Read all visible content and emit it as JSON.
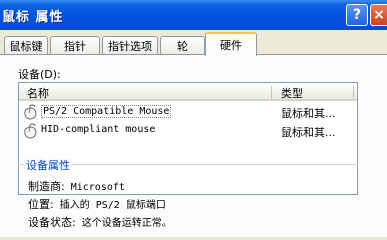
{
  "window": {
    "title": "鼠标 属性",
    "help_label": "?",
    "close_label": "×"
  },
  "tabs": [
    {
      "label": "鼠标键",
      "active": false
    },
    {
      "label": "指针",
      "active": false
    },
    {
      "label": "指针选项",
      "active": false
    },
    {
      "label": "轮",
      "active": false
    },
    {
      "label": "硬件",
      "active": true
    }
  ],
  "devices": {
    "label": "设备(D):",
    "columns": {
      "name": "名称",
      "type": "类型"
    },
    "rows": [
      {
        "name": "PS/2 Compatible Mouse",
        "type": "鼠标和其...",
        "selected": true,
        "icon": "mouse-icon"
      },
      {
        "name": "HID-compliant mouse",
        "type": "鼠标和其...",
        "selected": false,
        "icon": "mouse-icon"
      }
    ]
  },
  "properties": {
    "group_title": "设备属性",
    "manufacturer_label": "制造商:",
    "manufacturer_value": "Microsoft",
    "location_label": "位置:",
    "location_value": "插入的 PS/2 鼠标端口",
    "status_label": "设备状态:",
    "status_value": "这个设备运转正常。"
  },
  "colors": {
    "titlebar": "#0053de",
    "face": "#ece9d8",
    "active_tab_accent": "#ffc73c",
    "group_title": "#0046d5"
  }
}
